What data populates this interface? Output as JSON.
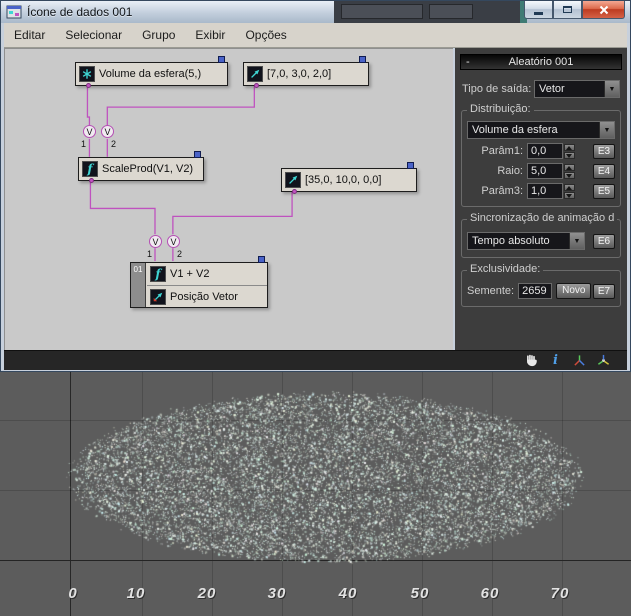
{
  "window": {
    "title": "Ícone de dados 001"
  },
  "menu": {
    "items": [
      "Editar",
      "Selecionar",
      "Grupo",
      "Exibir",
      "Opções"
    ]
  },
  "graph": {
    "nodes": {
      "sphere_volume": {
        "label": "Volume da esfera(5,)"
      },
      "vector_a": {
        "label": "[7,0, 3,0, 2,0]"
      },
      "scaleprod": {
        "label": "ScaleProd(V1, V2)"
      },
      "vector_b": {
        "label": "[35,0, 10,0, 0,0]"
      },
      "output": {
        "badge": "01",
        "row1": "V1 + V2",
        "row2": "Posição Vetor"
      }
    },
    "v_label": "V",
    "port_numbers": [
      "1",
      "2"
    ]
  },
  "panel": {
    "header": "Aleatório 001",
    "collapse": "-",
    "output_type_label": "Tipo de saída:",
    "output_type_value": "Vetor",
    "distribution_group": "Distribuição:",
    "distribution_value": "Volume da esfera",
    "params": [
      {
        "label": "Parâm1:",
        "value": "0,0",
        "expose": "E3"
      },
      {
        "label": "Raio:",
        "value": "5,0",
        "expose": "E4"
      },
      {
        "label": "Parâm3:",
        "value": "1,0",
        "expose": "E5"
      }
    ],
    "sync_group": "Sincronização de animação d",
    "sync_value": "Tempo absoluto",
    "sync_expose": "E6",
    "uniqueness_group": "Exclusividade:",
    "seed_label": "Semente:",
    "seed_value": "2659",
    "new_button": "Novo",
    "seed_expose": "E7"
  },
  "viewport": {
    "axis_labels": [
      "0",
      "10",
      "20",
      "30",
      "40",
      "50",
      "60",
      "70"
    ]
  },
  "icons": {
    "dropdown_arrow": "▼",
    "info_glyph": "i",
    "function_glyph": "f"
  },
  "colors": {
    "wire": "#bf52bf",
    "inlet": "#4a63c8",
    "node_icon": "#3fd6d4",
    "close_button": "#bd3b20"
  }
}
